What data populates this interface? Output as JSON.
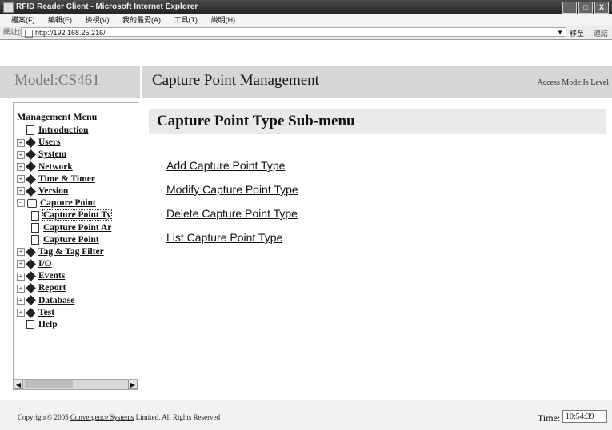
{
  "window": {
    "title": "RFID Reader Client - Microsoft Internet Explorer",
    "controls": [
      "_",
      "□",
      "X"
    ]
  },
  "menubar": {
    "items": [
      "檔案(F)",
      "編輯(E)",
      "檢視(V)",
      "我的最愛(A)",
      "工具(T)",
      "說明(H)"
    ]
  },
  "addressbar": {
    "label": "網址(D)",
    "url": "http://192.168.25.216/",
    "go_label": "移至",
    "links_label": "連結"
  },
  "header": {
    "model": "Model:CS461",
    "title": "Capture Point Management",
    "access": "Access Mode:Is Level"
  },
  "menu": {
    "title": "Management Menu",
    "items": [
      {
        "label": "Introduction"
      },
      {
        "label": "Users"
      },
      {
        "label": "System"
      },
      {
        "label": "Network"
      },
      {
        "label": "Time & Timer"
      },
      {
        "label": "Version"
      },
      {
        "label": "Capture Point"
      },
      {
        "label": "Capture Point Ty"
      },
      {
        "label": "Capture Point Ar"
      },
      {
        "label": "Capture Point"
      },
      {
        "label": "Tag & Tag Filter"
      },
      {
        "label": "I/O"
      },
      {
        "label": "Events"
      },
      {
        "label": "Report"
      },
      {
        "label": "Database"
      },
      {
        "label": "Test"
      },
      {
        "label": "Help"
      }
    ]
  },
  "content": {
    "heading": "Capture Point Type Sub-menu",
    "links": [
      "Add Capture Point Type",
      "Modify Capture Point Type",
      "Delete Capture Point Type",
      "List Capture Point Type"
    ]
  },
  "footer": {
    "copyright_prefix": "Copyright© 2005 ",
    "company": "Convergence Systems",
    "copyright_suffix": " Limited. All Rights Reserved",
    "time_label": "Time:",
    "time_value": "10:54:39"
  }
}
